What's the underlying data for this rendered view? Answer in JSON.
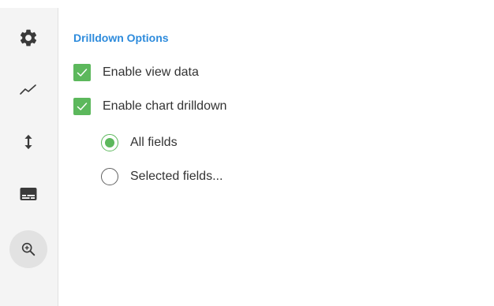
{
  "sidebar": {
    "items": [
      {
        "icon": "gear-icon",
        "active": false
      },
      {
        "icon": "line-chart-icon",
        "active": false
      },
      {
        "icon": "vertical-resize-icon",
        "active": false
      },
      {
        "icon": "subtitles-icon",
        "active": false
      },
      {
        "icon": "zoom-in-icon",
        "active": true
      }
    ]
  },
  "drilldown": {
    "title": "Drilldown Options",
    "enable_view_data": {
      "label": "Enable view data",
      "checked": true
    },
    "enable_chart_drilldown": {
      "label": "Enable chart drilldown",
      "checked": true
    },
    "fields_mode": {
      "options": [
        {
          "label": "All fields",
          "selected": true
        },
        {
          "label": "Selected fields...",
          "selected": false
        }
      ]
    }
  },
  "colors": {
    "accent_blue": "#2d8bdc",
    "check_green": "#5cb85c",
    "icon_dark": "#3a3a3a",
    "sidebar_bg": "#f4f4f4",
    "active_bg": "#e2e2e2"
  }
}
